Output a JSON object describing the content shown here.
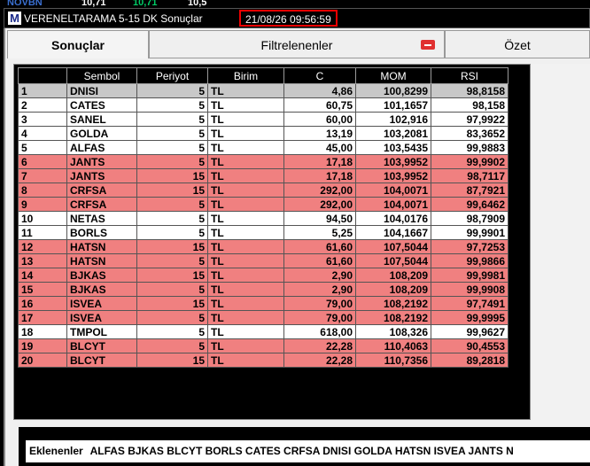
{
  "window": {
    "icon_letter": "M",
    "title": "VERENELTARAMA 5-15 DK Sonuçlar",
    "timestamp": "21/08/26 09:56:59"
  },
  "tabs": [
    {
      "label": "Sonuçlar",
      "active": true
    },
    {
      "label": "Filtrelenenler",
      "active": false,
      "badge": "minus"
    },
    {
      "label": "Özet",
      "active": false
    }
  ],
  "table": {
    "columns": [
      "",
      "Sembol",
      "Periyot",
      "Birim",
      "C",
      "MOM",
      "RSI"
    ],
    "rows": [
      {
        "n": "1",
        "sym": "DNISI",
        "per": "5",
        "unit": "TL",
        "c": "4,86",
        "mom": "100,8299",
        "rsi": "98,8158",
        "style": "gray"
      },
      {
        "n": "2",
        "sym": "CATES",
        "per": "5",
        "unit": "TL",
        "c": "60,75",
        "mom": "101,1657",
        "rsi": "98,158",
        "style": "white"
      },
      {
        "n": "3",
        "sym": "SANEL",
        "per": "5",
        "unit": "TL",
        "c": "60,00",
        "mom": "102,916",
        "rsi": "97,9922",
        "style": "white"
      },
      {
        "n": "4",
        "sym": "GOLDA",
        "per": "5",
        "unit": "TL",
        "c": "13,19",
        "mom": "103,2081",
        "rsi": "83,3652",
        "style": "white"
      },
      {
        "n": "5",
        "sym": "ALFAS",
        "per": "5",
        "unit": "TL",
        "c": "45,00",
        "mom": "103,5435",
        "rsi": "99,9883",
        "style": "white"
      },
      {
        "n": "6",
        "sym": "JANTS",
        "per": "5",
        "unit": "TL",
        "c": "17,18",
        "mom": "103,9952",
        "rsi": "99,9902",
        "style": "red"
      },
      {
        "n": "7",
        "sym": "JANTS",
        "per": "15",
        "unit": "TL",
        "c": "17,18",
        "mom": "103,9952",
        "rsi": "98,7117",
        "style": "red"
      },
      {
        "n": "8",
        "sym": "CRFSA",
        "per": "15",
        "unit": "TL",
        "c": "292,00",
        "mom": "104,0071",
        "rsi": "87,7921",
        "style": "red"
      },
      {
        "n": "9",
        "sym": "CRFSA",
        "per": "5",
        "unit": "TL",
        "c": "292,00",
        "mom": "104,0071",
        "rsi": "99,6462",
        "style": "red"
      },
      {
        "n": "10",
        "sym": "NETAS",
        "per": "5",
        "unit": "TL",
        "c": "94,50",
        "mom": "104,0176",
        "rsi": "98,7909",
        "style": "white"
      },
      {
        "n": "11",
        "sym": "BORLS",
        "per": "5",
        "unit": "TL",
        "c": "5,25",
        "mom": "104,1667",
        "rsi": "99,9901",
        "style": "white"
      },
      {
        "n": "12",
        "sym": "HATSN",
        "per": "15",
        "unit": "TL",
        "c": "61,60",
        "mom": "107,5044",
        "rsi": "97,7253",
        "style": "red"
      },
      {
        "n": "13",
        "sym": "HATSN",
        "per": "5",
        "unit": "TL",
        "c": "61,60",
        "mom": "107,5044",
        "rsi": "99,9866",
        "style": "red"
      },
      {
        "n": "14",
        "sym": "BJKAS",
        "per": "15",
        "unit": "TL",
        "c": "2,90",
        "mom": "108,209",
        "rsi": "99,9981",
        "style": "red"
      },
      {
        "n": "15",
        "sym": "BJKAS",
        "per": "5",
        "unit": "TL",
        "c": "2,90",
        "mom": "108,209",
        "rsi": "99,9908",
        "style": "red"
      },
      {
        "n": "16",
        "sym": "ISVEA",
        "per": "15",
        "unit": "TL",
        "c": "79,00",
        "mom": "108,2192",
        "rsi": "97,7491",
        "style": "red"
      },
      {
        "n": "17",
        "sym": "ISVEA",
        "per": "5",
        "unit": "TL",
        "c": "79,00",
        "mom": "108,2192",
        "rsi": "99,9995",
        "style": "red"
      },
      {
        "n": "18",
        "sym": "TMPOL",
        "per": "5",
        "unit": "TL",
        "c": "618,00",
        "mom": "108,326",
        "rsi": "99,9627",
        "style": "white"
      },
      {
        "n": "19",
        "sym": "BLCYT",
        "per": "5",
        "unit": "TL",
        "c": "22,28",
        "mom": "110,4063",
        "rsi": "90,4553",
        "style": "red"
      },
      {
        "n": "20",
        "sym": "BLCYT",
        "per": "15",
        "unit": "TL",
        "c": "22,28",
        "mom": "110,7356",
        "rsi": "89,2818",
        "style": "red"
      }
    ]
  },
  "footer": {
    "label": "Eklenenler",
    "symbols": "ALFAS BJKAS BLCYT BORLS CATES CRFSA DNISI GOLDA HATSN ISVEA JANTS N"
  },
  "colors": {
    "highlight_row": "#f08080",
    "selected_row": "#c8c8c8",
    "timestamp_border": "#e00000"
  }
}
